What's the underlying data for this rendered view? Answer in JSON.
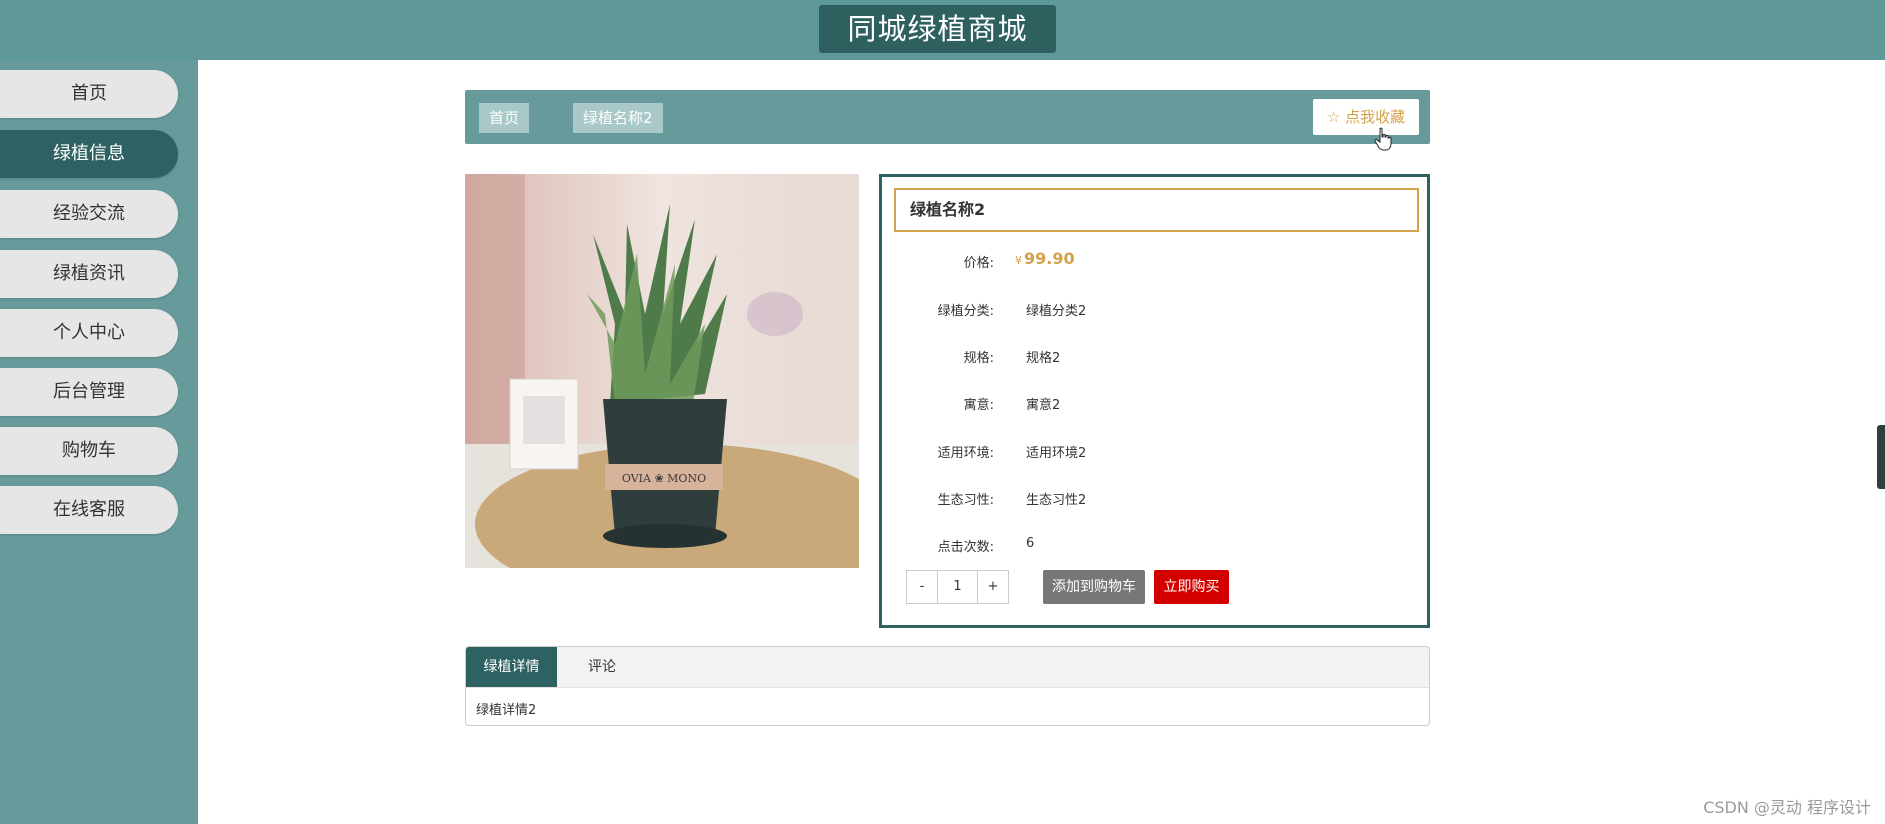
{
  "header": {
    "title": "同城绿植商城"
  },
  "sidebar": {
    "items": [
      {
        "label": "首页"
      },
      {
        "label": "绿植信息"
      },
      {
        "label": "经验交流"
      },
      {
        "label": "绿植资讯"
      },
      {
        "label": "个人中心"
      },
      {
        "label": "后台管理"
      },
      {
        "label": "购物车"
      },
      {
        "label": "在线客服"
      }
    ]
  },
  "breadcrumb": {
    "home": "首页",
    "current": "绿植名称2"
  },
  "favorite": {
    "icon": "star-icon",
    "label": "点我收藏"
  },
  "product": {
    "name": "绿植名称2",
    "price_label": "价格:",
    "currency": "¥",
    "price": "99.90",
    "fields": [
      {
        "label": "绿植分类:",
        "value": "绿植分类2"
      },
      {
        "label": "规格:",
        "value": "规格2"
      },
      {
        "label": "寓意:",
        "value": "寓意2"
      },
      {
        "label": "适用环境:",
        "value": "适用环境2"
      },
      {
        "label": "生态习性:",
        "value": "生态习性2"
      },
      {
        "label": "点击次数:",
        "value": "6"
      }
    ],
    "quantity": {
      "minus": "-",
      "value": "1",
      "plus": "+"
    },
    "add_to_cart": "添加到购物车",
    "buy_now": "立即购买",
    "pot_text": "OVIA ❀ MONO"
  },
  "tabs": {
    "items": [
      {
        "label": "绿植详情"
      },
      {
        "label": "评论"
      }
    ],
    "content": "绿植详情2"
  },
  "watermark": "CSDN @灵动 程序设计",
  "colors": {
    "header": "#5f9898",
    "title_bg": "#2f6060",
    "sidebar": "#679b9b",
    "active": "#2e6262",
    "accent": "#d4a24a",
    "buy": "#d40000"
  }
}
